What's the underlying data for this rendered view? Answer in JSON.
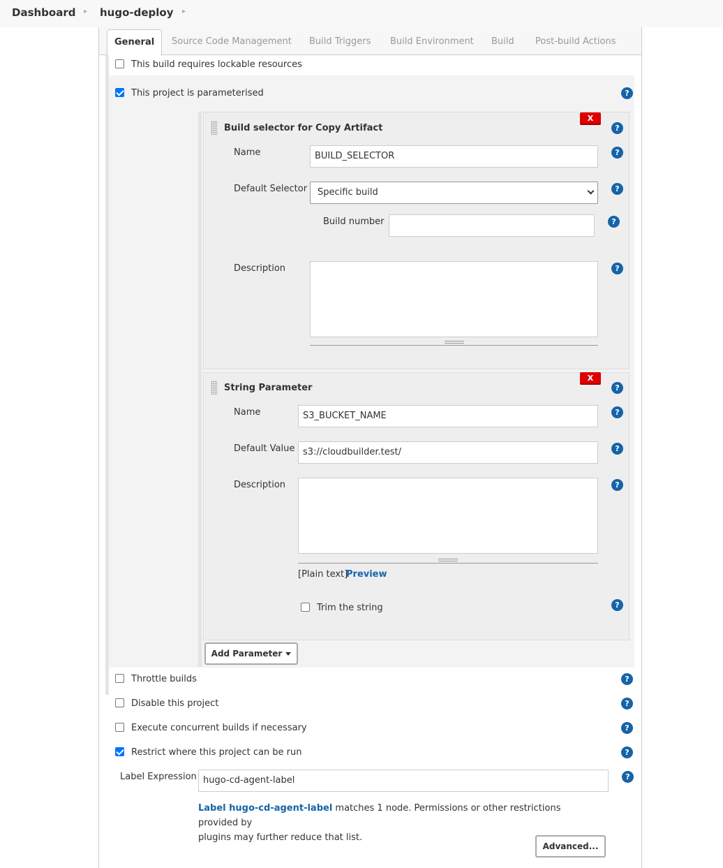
{
  "breadcrumb": {
    "items": [
      "Dashboard",
      "hugo-deploy"
    ]
  },
  "tabs": [
    "General",
    "Source Code Management",
    "Build Triggers",
    "Build Environment",
    "Build",
    "Post-build Actions"
  ],
  "general": {
    "lockable": "This build requires lockable resources",
    "parameterised": "This project is parameterised",
    "throttle": "Throttle builds",
    "disable": "Disable this project",
    "concurrent": "Execute concurrent builds if necessary",
    "restrict": "Restrict where this project can be run"
  },
  "param1": {
    "title": "Build selector for Copy Artifact",
    "delete": "X",
    "name_label": "Name",
    "name_value": "BUILD_SELECTOR",
    "selector_label": "Default Selector",
    "selector_value": "Specific build",
    "build_number_label": "Build number",
    "build_number_value": "",
    "description_label": "Description"
  },
  "param2": {
    "title": "String Parameter",
    "delete": "X",
    "name_label": "Name",
    "name_value": "S3_BUCKET_NAME",
    "default_label": "Default Value",
    "default_value": "s3://cloudbuilder.test/",
    "description_label": "Description",
    "plain_text": "[Plain text]",
    "preview": "Preview",
    "trim": "Trim the string"
  },
  "add_parameter": "Add Parameter",
  "label_expression": {
    "label": "Label Expression",
    "value": "hugo-cd-agent-label",
    "info_link": "Label hugo-cd-agent-label",
    "info_rest1": " matches 1 node. Permissions or other restrictions provided by",
    "info_rest2": "plugins may further reduce that list."
  },
  "advanced": "Advanced...",
  "help_glyph": "?",
  "colors": {
    "accent": "#1564a8",
    "danger": "#dd0000",
    "checkbox": "#0075ff"
  }
}
